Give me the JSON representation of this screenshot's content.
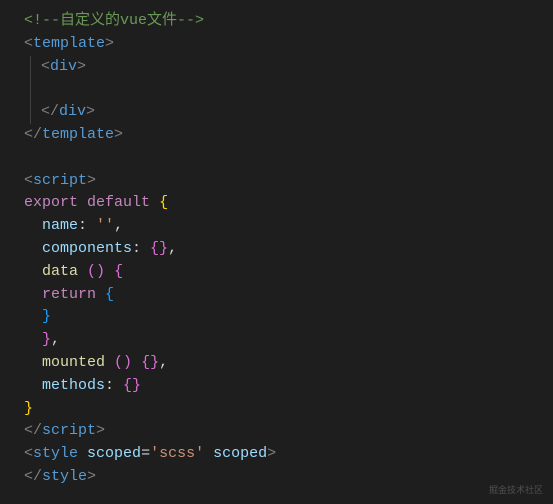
{
  "code": {
    "comment": "<!--自定义的vue文件-->",
    "gt": ">",
    "lt": "<",
    "slash": "/",
    "template": "template",
    "div": "div",
    "script": "script",
    "style": "style",
    "export": "export",
    "default": "default",
    "name_prop": "name",
    "components_prop": "components",
    "data_prop": "data",
    "return_kw": "return",
    "mounted_prop": "mounted",
    "methods_prop": "methods",
    "empty_string": "''",
    "scoped_attr": "scoped",
    "scss_val": "'scss'",
    "colon_sp": ": ",
    "comma": ",",
    "open_brace": "{",
    "close_brace": "}",
    "open_close_brace": "{}",
    "open_paren": "(",
    "close_paren": ")",
    "paren_pair": "()",
    "eq": "=",
    "sp": " ",
    "sp2": "  ",
    "sp4": "    "
  },
  "watermark": "掘金技术社区"
}
